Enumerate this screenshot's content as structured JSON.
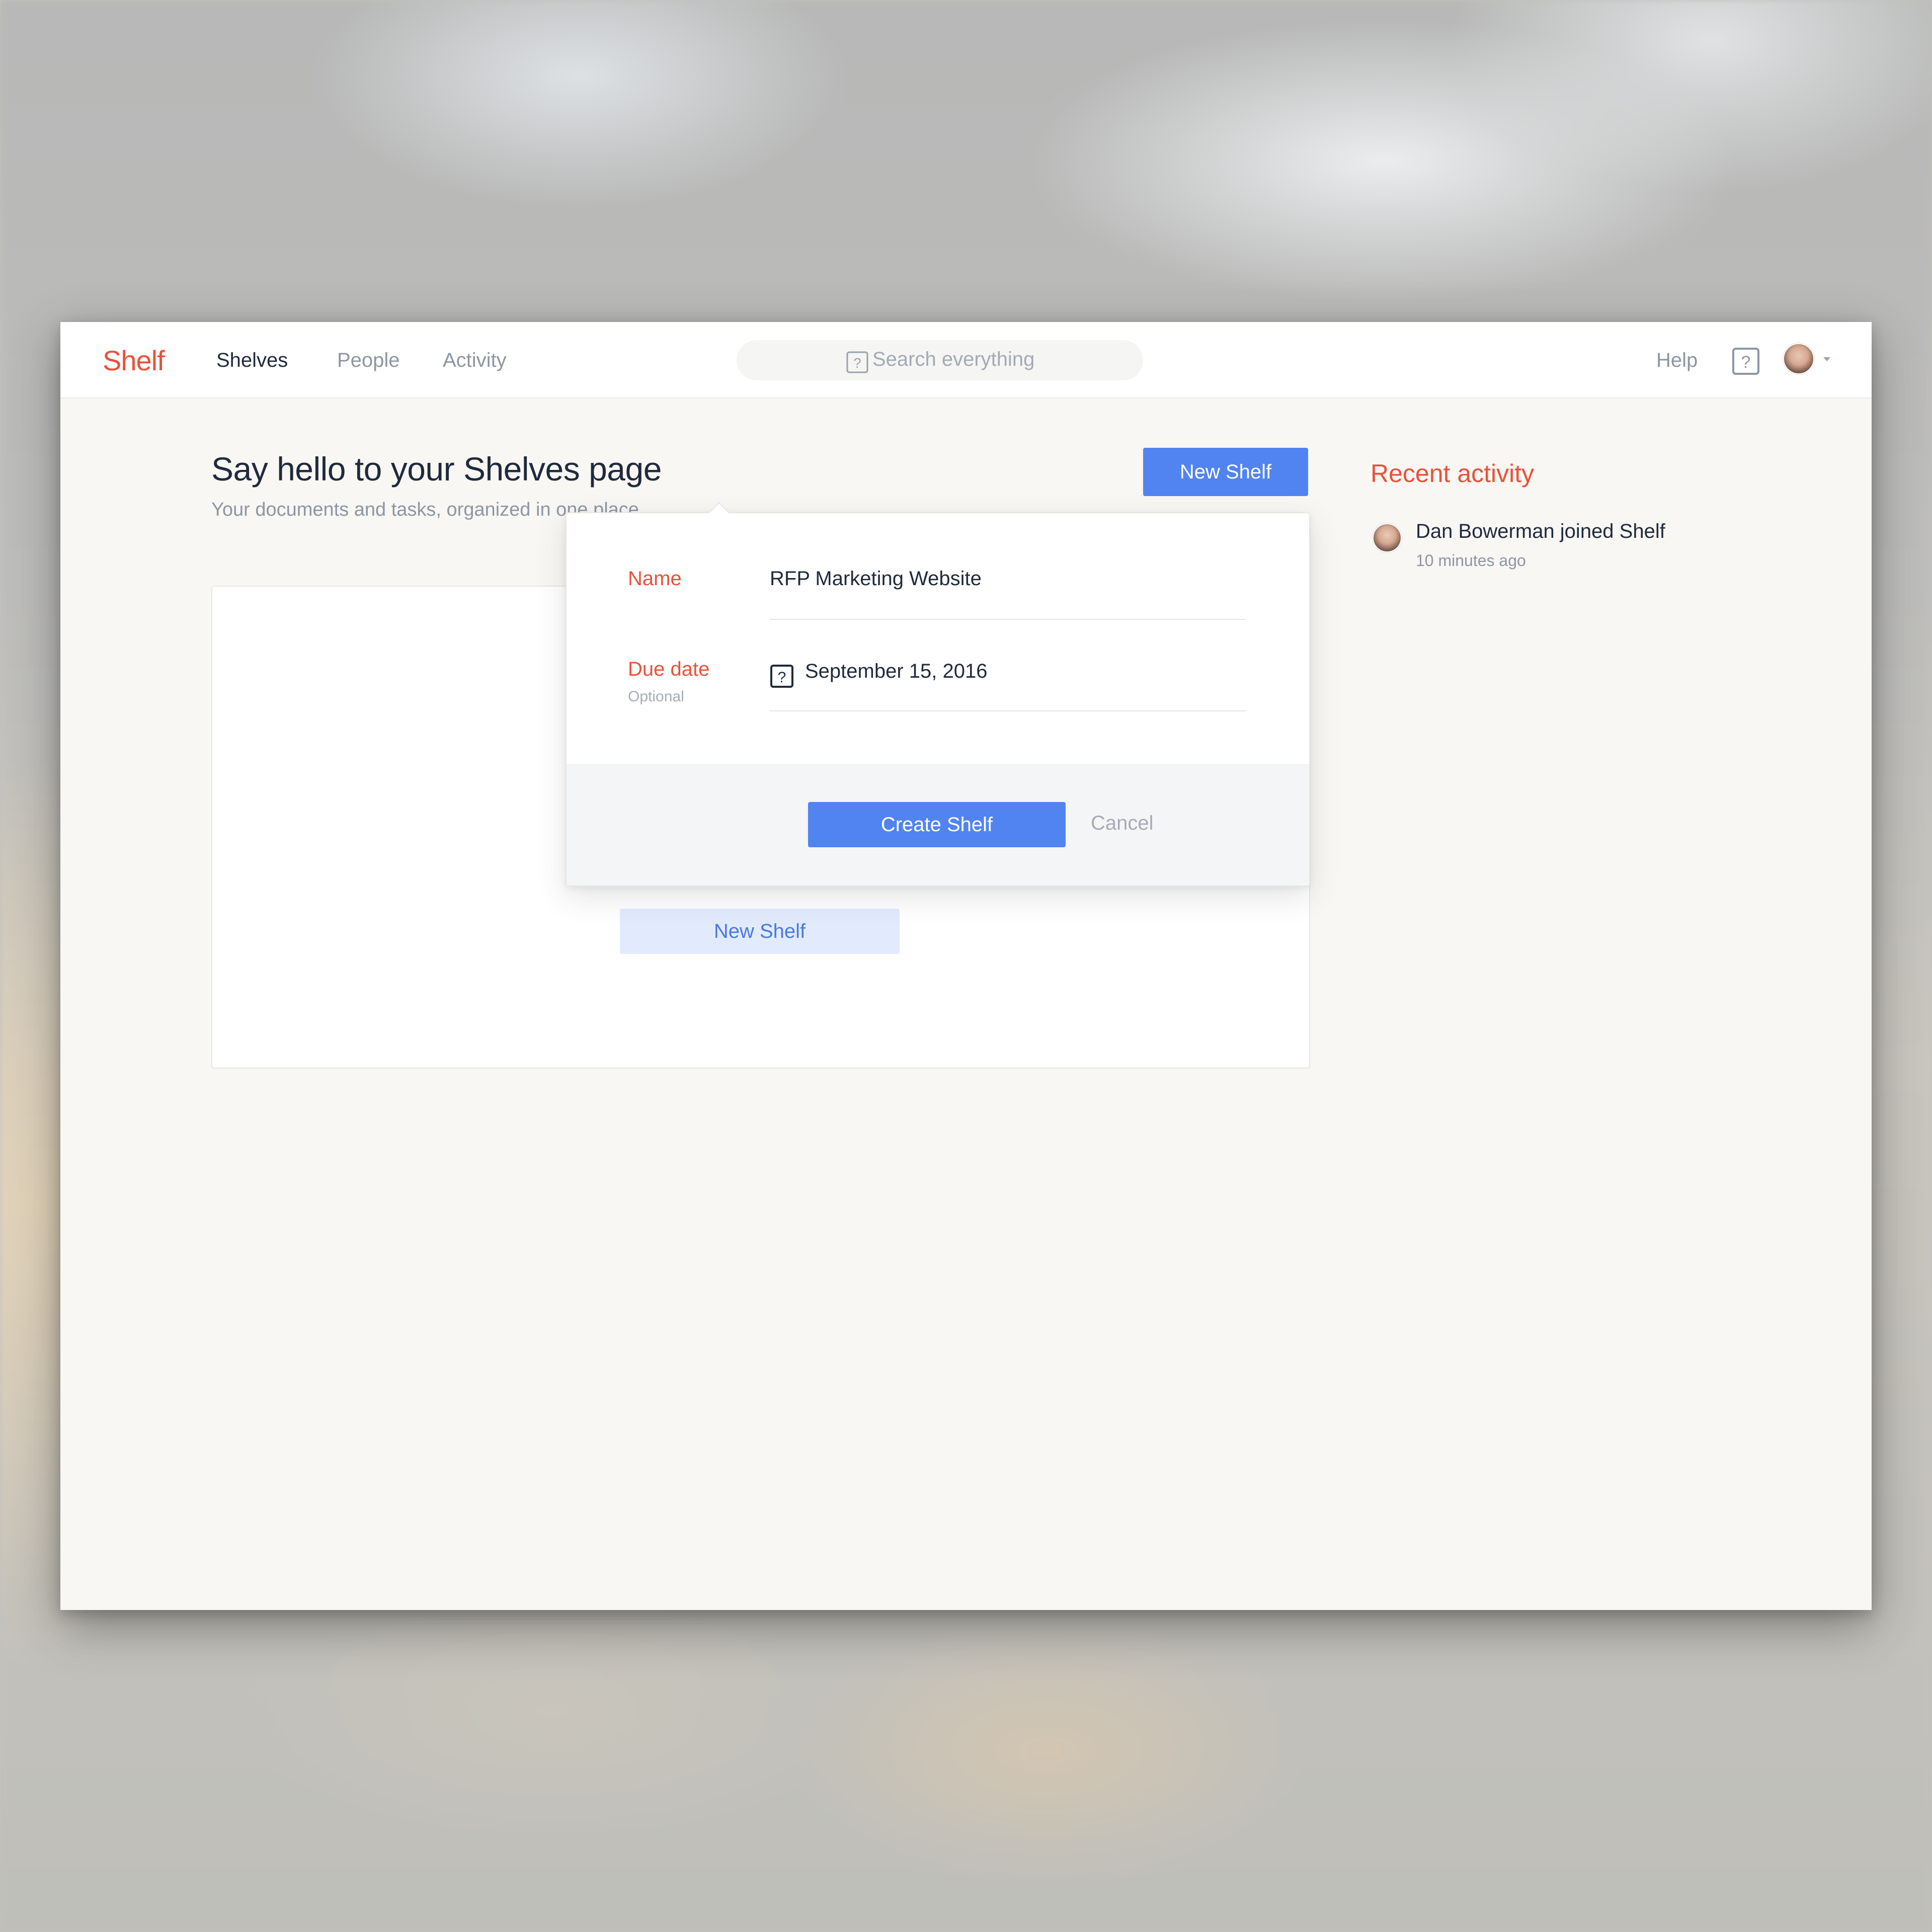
{
  "app": {
    "logo": "Shelf"
  },
  "nav": {
    "items": [
      {
        "label": "Shelves",
        "active": true
      },
      {
        "label": "People",
        "active": false
      },
      {
        "label": "Activity",
        "active": false
      }
    ]
  },
  "search": {
    "placeholder": "Search everything"
  },
  "header_right": {
    "help_label": "Help",
    "help_icon": "question-box-icon",
    "avatar_icon": "user-avatar"
  },
  "main": {
    "title": "Say hello to your Shelves page",
    "subtitle": "Your documents and tasks, organized in one place",
    "new_shelf_button": "New Shelf",
    "empty_card_button": "New Shelf"
  },
  "popover": {
    "name_label": "Name",
    "name_value": "RFP Marketing Website",
    "due_label": "Due date",
    "due_hint": "Optional",
    "due_value": "September 15, 2016",
    "create_button": "Create Shelf",
    "cancel_button": "Cancel"
  },
  "activity": {
    "title": "Recent activity",
    "items": [
      {
        "text": "Dan Bowerman joined Shelf",
        "time": "10 minutes ago"
      }
    ]
  },
  "colors": {
    "brand": "#e8523a",
    "primary": "#5184f1",
    "text": "#1f2a3c",
    "muted": "#8d96a3"
  }
}
